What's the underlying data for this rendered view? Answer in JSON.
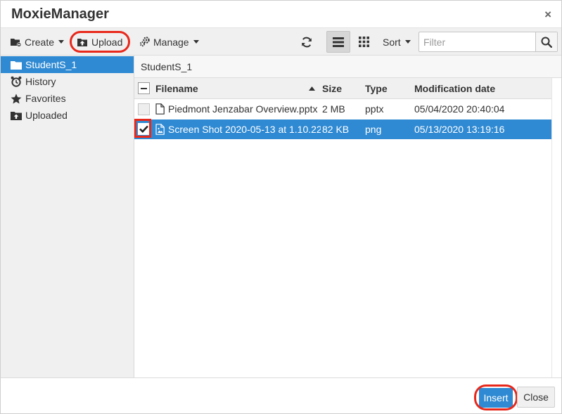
{
  "dialog": {
    "title": "MoxieManager",
    "close_glyph": "×"
  },
  "toolbar": {
    "create_label": "Create",
    "upload_label": "Upload",
    "manage_label": "Manage",
    "sort_label": "Sort",
    "filter_placeholder": "Filter",
    "filter_value": ""
  },
  "sidebar": {
    "items": [
      {
        "label": "StudentS_1",
        "icon": "folder-icon",
        "selected": true
      },
      {
        "label": "History",
        "icon": "alarm-clock-icon",
        "selected": false
      },
      {
        "label": "Favorites",
        "icon": "star-icon",
        "selected": false
      },
      {
        "label": "Uploaded",
        "icon": "upload-icon",
        "selected": false
      }
    ]
  },
  "breadcrumb": {
    "path": "StudentS_1"
  },
  "grid": {
    "columns": {
      "filename": "Filename",
      "size": "Size",
      "type": "Type",
      "modified": "Modification date"
    },
    "sort_column": "Filename",
    "sort_direction": "ascending",
    "rows": [
      {
        "filename": "Piedmont Jenzabar Overview.pptx",
        "size": "2 MB",
        "type": "pptx",
        "modified": "05/04/2020 20:40:04",
        "icon": "document-icon",
        "checked": false,
        "selected": false
      },
      {
        "filename": "Screen Shot 2020-05-13 at 1.10.22",
        "size": "82 KB",
        "type": "png",
        "modified": "05/13/2020 13:19:16",
        "icon": "image-icon",
        "checked": true,
        "selected": true
      }
    ]
  },
  "footer": {
    "insert_label": "Insert",
    "close_label": "Close"
  },
  "colors": {
    "accent": "#2f8ad3",
    "highlight_ring": "#e8281b"
  }
}
